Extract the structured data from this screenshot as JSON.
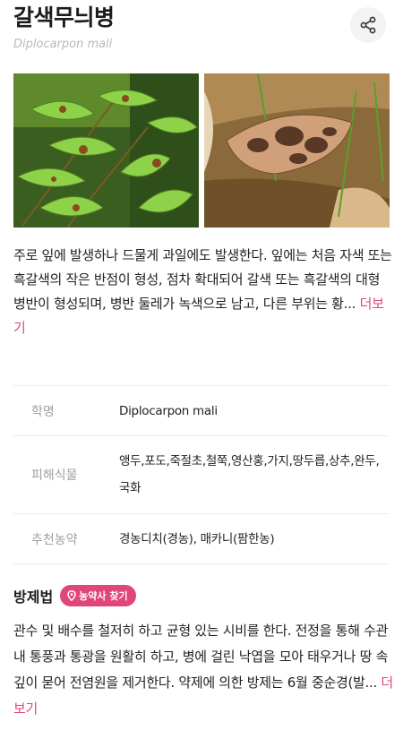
{
  "header": {
    "title": "갈색무늬병",
    "scientific_name": "Diplocarpon mali",
    "share_icon": "share-icon"
  },
  "photos": [
    {
      "name": "leaves-on-branch-photo"
    },
    {
      "name": "fallen-leaf-photo"
    }
  ],
  "description": {
    "text": "주로 잎에 발생하나 드물게 과일에도 발생한다. 잎에는 처음 자색 또는 흑갈색의 작은 반점이 형성, 점차 확대되어 갈색 또는 흑갈색의 대형 병반이 형성되며, 병반 둘레가 녹색으로 남고, 다른 부위는 황... ",
    "more": "더보기"
  },
  "info": {
    "scientific_label": "학명",
    "scientific_value": "Diplocarpon mali",
    "hosts_label": "피해식물",
    "hosts_value": "앵두,포도,죽절초,철쭉,영산홍,가지,땅두릅,상추,완두,국화",
    "pesticide_label": "추천농약",
    "pesticide_value": "경농디치(경농), 매카니(팜한농)"
  },
  "control": {
    "title": "방제법",
    "find_button": "농약사 찾기",
    "text": "관수 및 배수를 철저히 하고 균형 있는 시비를 한다. 전정을 통해 수관내 통풍과 통광을 원활히 하고, 병에 걸린 낙엽을 모아 태우거나 땅 속 깊이 묻어 전염원을 제거한다. 약제에 의한 방제는 6월 중순경(발... ",
    "more": "더보기"
  },
  "colors": {
    "accent": "#e0457b",
    "muted": "#a0a0a0"
  }
}
